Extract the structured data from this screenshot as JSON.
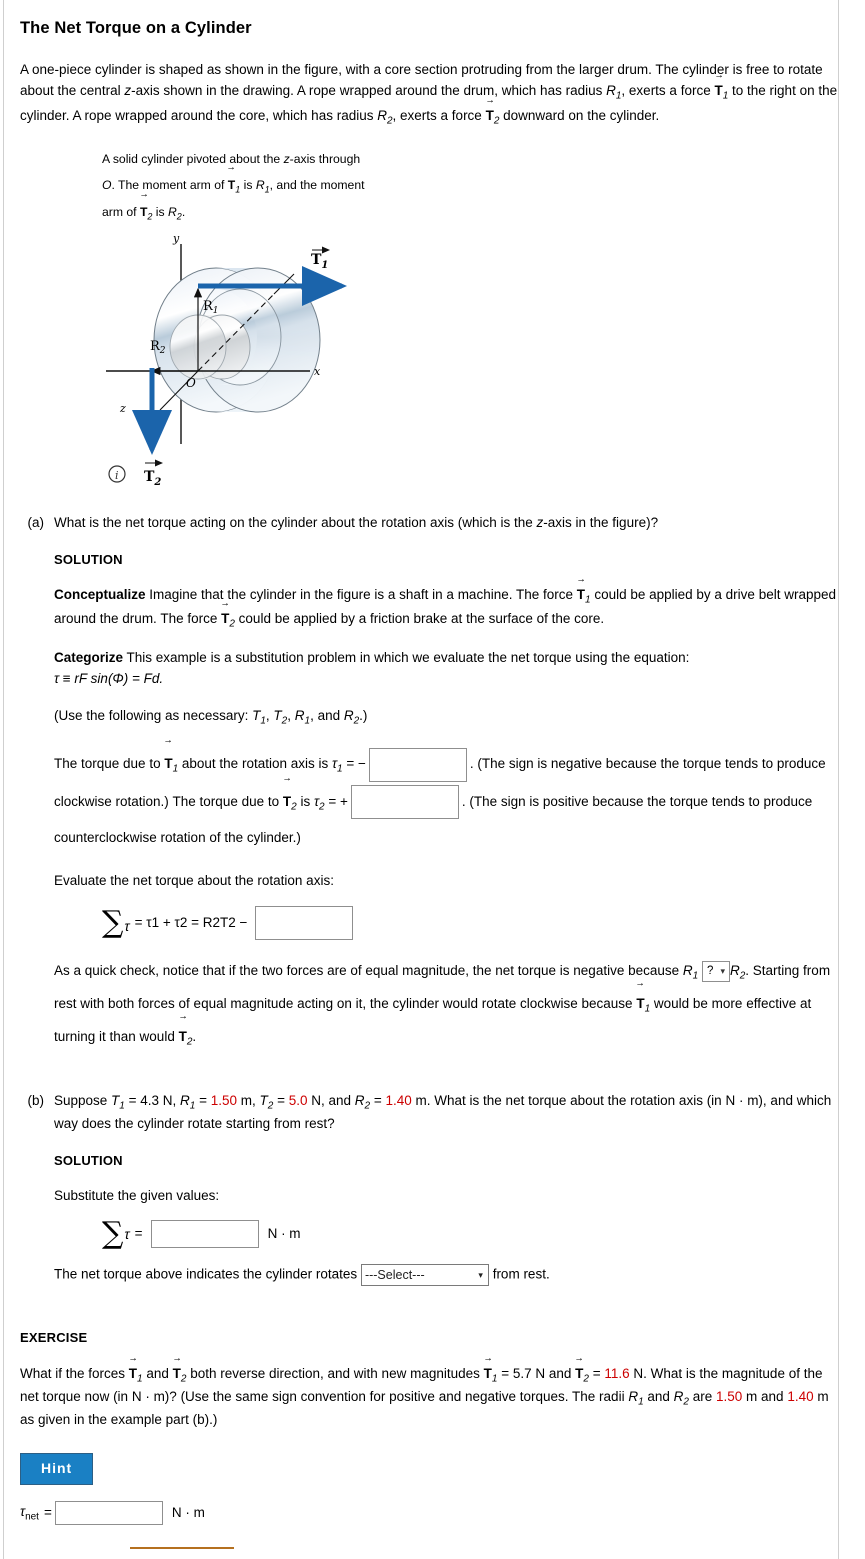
{
  "page": {
    "title": "The Net Torque on a Cylinder",
    "intro": "A one-piece cylinder is shaped as shown in the figure, with a core section protruding from the larger drum. The cylinder is free to rotate about the central z-axis shown in the drawing. A rope wrapped around the drum, which has radius R1, exerts a force T1 to the right on the cylinder. A rope wrapped around the core, which has radius R2, exerts a force T2 downward on the cylinder."
  },
  "intro_text": {
    "s1": "A one-piece cylinder is shaped as shown in the figure, with a core section protruding from the larger drum. The cylinder is free to rotate about the central ",
    "s2": "-axis shown in the drawing. A rope wrapped around the drum, which has radius ",
    "s3": ", exerts a force ",
    "s4": " to the right on the cylinder. A rope wrapped around the core, which has radius ",
    "s5": ", exerts a force ",
    "s6": " downward on the cylinder."
  },
  "figure": {
    "caption_1": "A solid cylinder pivoted about the z-axis through",
    "caption_2a": ". The moment arm of ",
    "caption_2b": " is ",
    "caption_2c": ", and the moment",
    "caption_3a": "arm of ",
    "caption_3b": " is ",
    "labels": {
      "y_axis": "y",
      "x_axis": "x",
      "z_axis": "z",
      "origin": "O",
      "radius_outer": "R",
      "radius_outer_sub": "1",
      "radius_inner": "R",
      "radius_inner_sub": "2",
      "force_1": "T",
      "force_1_sub": "1",
      "force_2": "T",
      "force_2_sub": "2",
      "info": "i"
    },
    "colors": {
      "arrow_blue": "#1b64ab",
      "cylinder_light": "#eef3f8",
      "cylinder_mid": "#c8d8e6",
      "cylinder_edge": "#7d8a95"
    }
  },
  "part_a": {
    "label": "(a)",
    "question_1": "What is the net torque acting on the cylinder about the rotation axis (which is the ",
    "question_2": "-axis in the figure)?",
    "solution_heading": "SOLUTION",
    "conceptualize_lead": "Conceptualize",
    "conceptualize_1": " Imagine that the cylinder in the figure is a shaft in a machine. The force ",
    "conceptualize_2": " could be applied by a drive belt wrapped around the drum. The force ",
    "conceptualize_3": " could be applied by a friction brake at the surface of the core.",
    "categorize_lead": "Categorize",
    "categorize_1": " This example is a substitution problem in which we evaluate the net torque using the equation:",
    "categorize_eq": "τ ≡ rF sin(Φ) = Fd.",
    "use_following": "(Use the following as necessary: T1, T2, R1, and R2.)",
    "torque1_a": "The torque due to ",
    "torque1_b": " about the rotation axis is ",
    "torque1_c": " = −",
    "torque1_d": ". (The sign is negative because the torque tends to produce clockwise rotation.) The torque due to ",
    "torque1_e": " is ",
    "torque1_f": " = +",
    "torque1_g": ". (The sign is positive because the torque tends to produce counterclockwise rotation of the cylinder.)",
    "evaluate_label": "Evaluate the net torque about the rotation axis:",
    "sum_equation": "= τ1 + τ2 = R2T2 −",
    "quickcheck_1": "As a quick check, notice that if the two forces are of equal magnitude, the net torque is negative because ",
    "quickcheck_select": "?",
    "quickcheck_2": ". Starting from rest with both forces of equal magnitude acting on it, the cylinder would rotate clockwise because ",
    "quickcheck_3": " would be more effective at turning it than would ",
    "quickcheck_4": "."
  },
  "part_b": {
    "label": "(b)",
    "q_prefix": "Suppose ",
    "T1_eq": " = ",
    "T1_value": "4.3",
    "T1_unit": " N, ",
    "R1_value": "1.50",
    "R1_unit": " m, ",
    "T2_value": "5.0",
    "T2_unit": " N, and ",
    "R2_value": "1.40",
    "R2_unit": " m. What is the net torque about the rotation axis (in N · m), and which way does the cylinder rotate starting from rest?",
    "solution_heading": "SOLUTION",
    "substitute_label": "Substitute the given values:",
    "sum_units": "N · m",
    "rotate_text_before": "The net torque above indicates the cylinder rotates ",
    "rotate_select_value": "---Select---",
    "rotate_text_after": " from rest."
  },
  "exercise": {
    "heading": "EXERCISE",
    "q1": "What if the forces ",
    "q2": " and ",
    "q3": " both reverse direction, and with new magnitudes ",
    "q4": " = ",
    "T1_value": "5.7",
    "q5": " N and ",
    "q6": " = ",
    "T2_value": "11.6",
    "q7": " N. What is the magnitude of the net torque now (in N · m)? (Use the same sign convention for positive and negative torques. The radii ",
    "q8": " and ",
    "q9": " are ",
    "R1_value": "1.50",
    "q10": " m and ",
    "R2_value": "1.40",
    "q11": " m as given in the example part (b).)",
    "hint_label": "Hint",
    "tau_net_label": "τ",
    "tau_net_sub": "net",
    "tau_net_eq": " = ",
    "tau_net_units": "N · m"
  },
  "colors": {
    "hint_button": "#1a80c4",
    "hint_border": "#2c5f85",
    "red_value": "#cc0000",
    "arrow_blue": "#1b64ab",
    "orange_stub": "#b5701f"
  }
}
